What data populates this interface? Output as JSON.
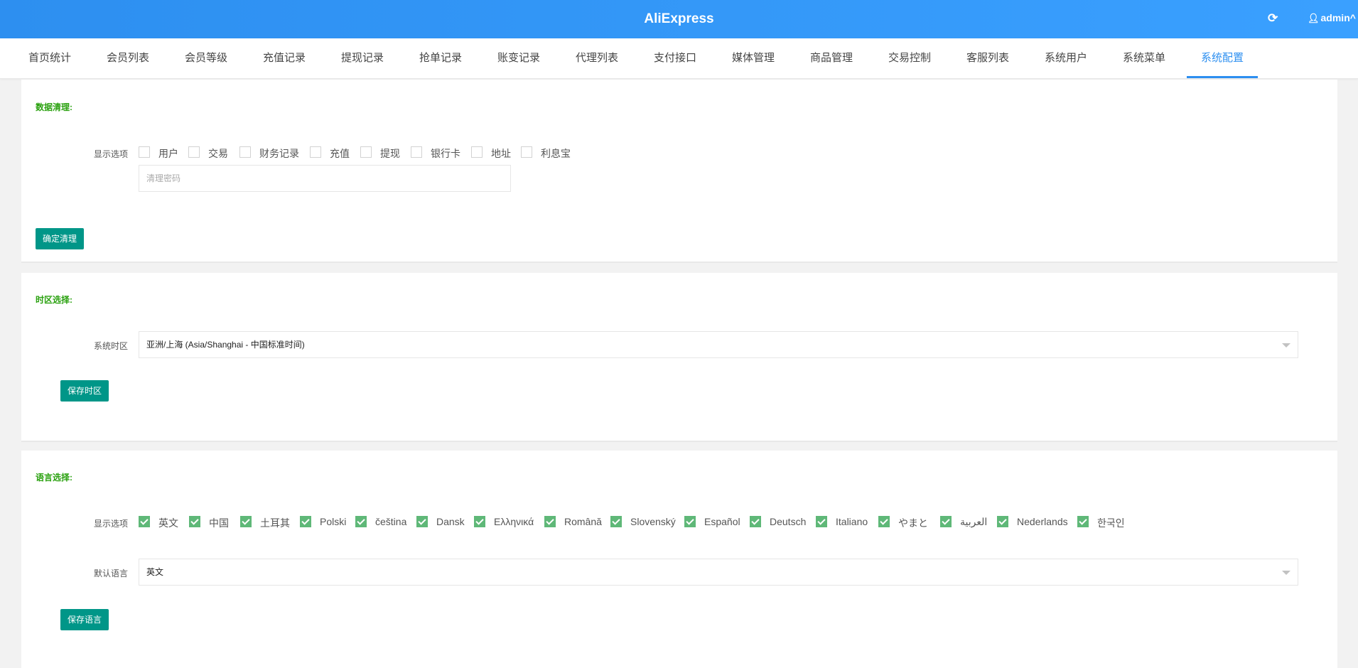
{
  "header": {
    "title": "AliExpress",
    "refresh_icon": "refresh-icon",
    "user_icon": "user-icon",
    "user": "admin",
    "user_caret": "^"
  },
  "nav": {
    "tabs": [
      "首页统计",
      "会员列表",
      "会员等级",
      "充值记录",
      "提现记录",
      "抢单记录",
      "账变记录",
      "代理列表",
      "支付接口",
      "媒体管理",
      "商品管理",
      "交易控制",
      "客服列表",
      "系统用户",
      "系统菜单",
      "系统配置"
    ],
    "active": "系统配置"
  },
  "data_clear": {
    "title": "数据清理:",
    "label": "显示选项",
    "options": [
      "用户",
      "交易",
      "财务记录",
      "充值",
      "提现",
      "银行卡",
      "地址",
      "利息宝"
    ],
    "password_placeholder": "清理密码",
    "button": "确定清理"
  },
  "timezone": {
    "title": "时区选择:",
    "label": "系统时区",
    "value": "亚洲/上海 (Asia/Shanghai - 中国标准时间)",
    "button": "保存时区"
  },
  "language": {
    "title": "语言选择:",
    "label": "显示选项",
    "options": [
      "英文",
      "中国",
      "土耳其",
      "Polski",
      "čeština",
      "Dansk",
      "Ελληνικά",
      "Română",
      "Slovenský",
      "Español",
      "Deutsch",
      "Italiano",
      "やまと",
      "العربية",
      "Nederlands",
      "한국인"
    ],
    "default_label": "默认语言",
    "default_value": "英文",
    "button": "保存语言"
  },
  "colors": {
    "header": "#2d8ff0",
    "section_title": "#2aa10f",
    "button": "#009688",
    "checkbox_on": "#5fb878"
  }
}
